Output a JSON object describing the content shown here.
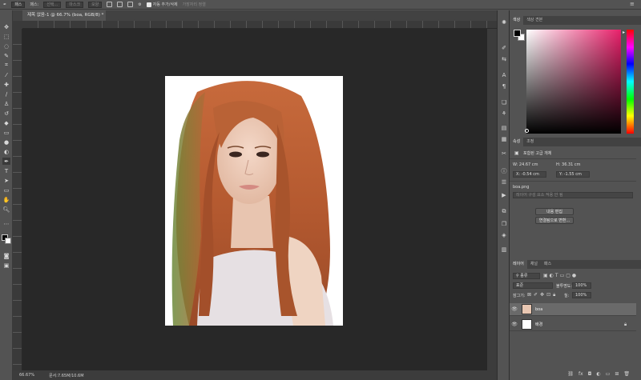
{
  "options_bar": {
    "mode": "패스",
    "shape_label": "패스:",
    "make_label": "선택...",
    "mask_label": "마스크",
    "shape_btn": "모양",
    "auto_add_delete": "자동 추가/삭제",
    "align_edges": "가장자리 정렬"
  },
  "document": {
    "tab_title": "제목 없음-1 @ 66.7% (boa, RGB/8) *"
  },
  "status": {
    "zoom": "66.67%",
    "doc_size": "문서:7.65M/10.6M"
  },
  "color_panel": {
    "tabs": [
      "색상",
      "색상 견본"
    ],
    "foreground": "#000000",
    "background": "#ffffff",
    "hue_color": "#e8206a"
  },
  "properties_panel": {
    "tabs": [
      "속성",
      "조정"
    ],
    "type_label": "포함된 고급 개체",
    "w": "W:  24.67 cm",
    "h": "H:  36.31 cm",
    "x": "X:  -0.54 cm",
    "y": "Y:  -1.55 cm",
    "filename": "boa.png",
    "comp_placeholder": "레이어 구성 요소 적용 안 됨",
    "edit_contents": "내용 편집",
    "convert_linked": "연결됨으로 변환..."
  },
  "layers_panel": {
    "tabs": [
      "레이어",
      "채널",
      "패스"
    ],
    "filter_kind": "종류",
    "blend_mode": "표준",
    "opacity_label": "불투명도:",
    "opacity_value": "100%",
    "lock_label": "잠그기:",
    "fill_label": "칠:",
    "fill_value": "100%",
    "layers": [
      {
        "name": "boa",
        "selected": true
      },
      {
        "name": "배경",
        "selected": false
      }
    ]
  }
}
